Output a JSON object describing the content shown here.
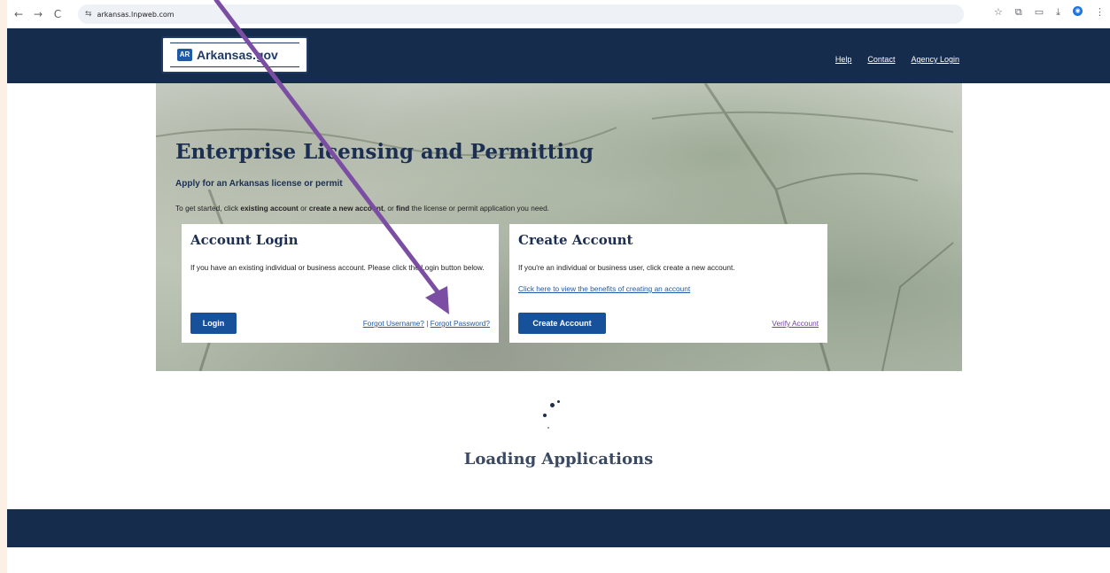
{
  "browser": {
    "back": "←",
    "forward": "→",
    "reload": "C",
    "url": "arkansas.lnpweb.com",
    "tune_icon": "⇆",
    "star_icon": "☆",
    "extensions_icon": "⧉",
    "tabsearch_icon": "▭",
    "download_icon": "⤓",
    "profile_icon": "◉",
    "menu_icon": "⋮"
  },
  "header": {
    "logo_badge": "AR",
    "logo_text": "Arkansas.gov",
    "links": [
      "Help",
      "Contact",
      "Agency Login"
    ]
  },
  "hero": {
    "title": "Enterprise Licensing and Permitting",
    "subtitle": "Apply for an Arkansas license or permit",
    "instructions": {
      "prefix": "To get started, click ",
      "existing": "existing account",
      "or1": " or ",
      "create": "create a new account",
      "or2": ", or ",
      "find": "find",
      "suffix": " the license or permit application you need."
    }
  },
  "login_card": {
    "title": "Account Login",
    "text": "If you have an existing individual or business account. Please click the Login button below.",
    "button": "Login",
    "forgot_username": "Forgot Username?",
    "separator": " | ",
    "forgot_password": "Forgot Password?"
  },
  "create_card": {
    "title": "Create Account",
    "text": "If you're an individual or business user, click create a new account.",
    "benefits_link": "Click here to view the benefits of creating an account",
    "button": "Create Account",
    "verify_link": "Verify Account"
  },
  "loading": {
    "text": "Loading Applications"
  },
  "colors": {
    "header_bg": "#162c4d",
    "button_bg": "#17519a",
    "annotation_arrow": "#7b4ea3"
  }
}
